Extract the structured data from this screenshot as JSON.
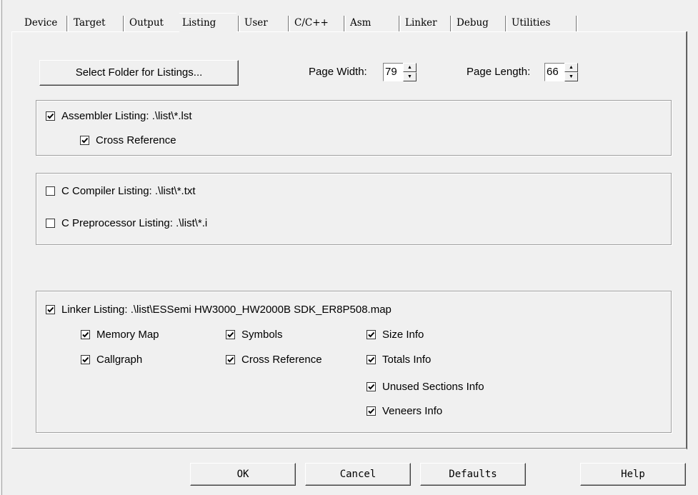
{
  "tabs": [
    "Device",
    "Target",
    "Output",
    "Listing",
    "User",
    "C/C++",
    "Asm",
    "Linker",
    "Debug",
    "Utilities"
  ],
  "active_tab": "Listing",
  "select_folder_button": "Select Folder for Listings...",
  "page_width": {
    "label": "Page Width:",
    "value": "79"
  },
  "page_length": {
    "label": "Page Length:",
    "value": "66"
  },
  "assembler": {
    "listing": {
      "label": "Assembler Listing:  .\\list\\*.lst",
      "checked": true
    },
    "cross_reference": {
      "label": "Cross Reference",
      "checked": true
    }
  },
  "compiler": {
    "c_compiler_listing": {
      "label": "C Compiler Listing:  .\\list\\*.txt",
      "checked": false
    },
    "c_preprocessor_listing": {
      "label": "C Preprocessor Listing:  .\\list\\*.i",
      "checked": false
    }
  },
  "linker": {
    "listing": {
      "label": "Linker Listing:  .\\list\\ESSemi HW3000_HW2000B SDK_ER8P508.map",
      "checked": true
    },
    "memory_map": {
      "label": "Memory Map",
      "checked": true
    },
    "callgraph": {
      "label": "Callgraph",
      "checked": true
    },
    "symbols": {
      "label": "Symbols",
      "checked": true
    },
    "cross_reference": {
      "label": "Cross Reference",
      "checked": true
    },
    "size_info": {
      "label": "Size Info",
      "checked": true
    },
    "totals_info": {
      "label": "Totals Info",
      "checked": true
    },
    "unused_sections_info": {
      "label": "Unused Sections Info",
      "checked": true
    },
    "veneers_info": {
      "label": "Veneers Info",
      "checked": true
    }
  },
  "buttons": {
    "ok": "OK",
    "cancel": "Cancel",
    "defaults": "Defaults",
    "help": "Help"
  },
  "colors": {
    "background": "#f0f0f0",
    "border_dark": "#808080",
    "border_light": "#ffffff"
  }
}
